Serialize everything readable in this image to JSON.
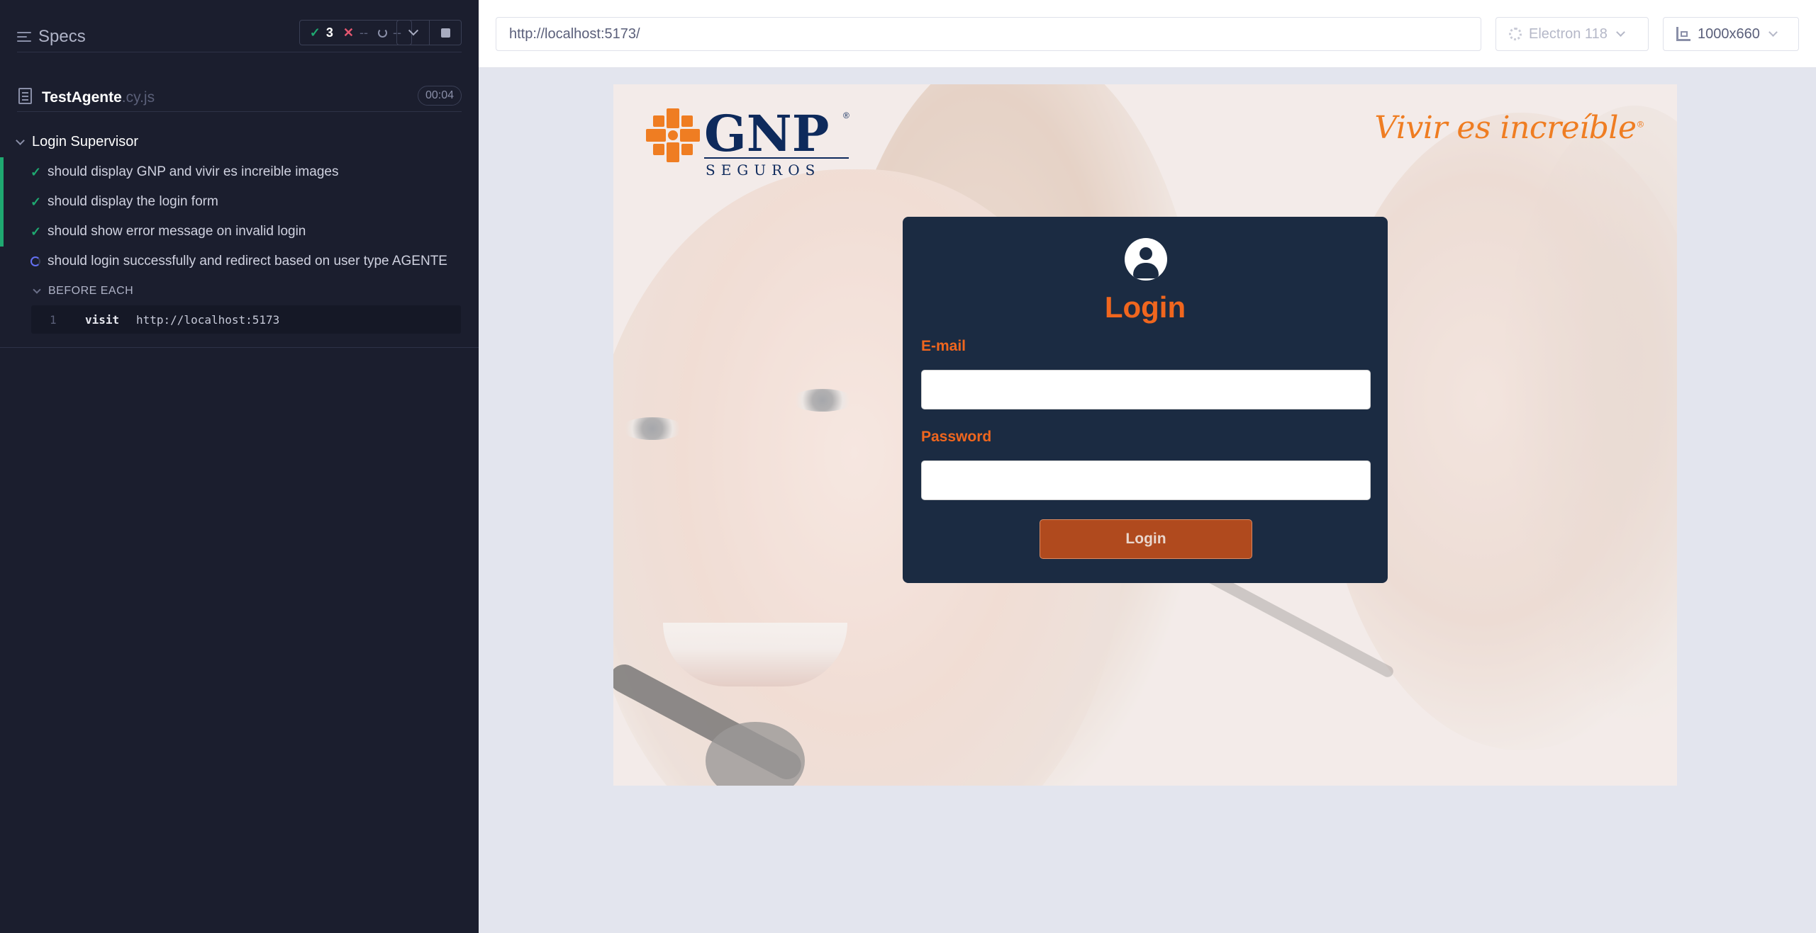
{
  "reporter": {
    "specs_label": "Specs",
    "stats": {
      "passed": "3",
      "failed": "--",
      "pending": "--"
    },
    "spec": {
      "name": "TestAgente",
      "ext": ".cy.js",
      "duration": "00:04"
    },
    "suite": {
      "title": "Login Supervisor",
      "tests": [
        {
          "label": "should display GNP and vivir es increible images",
          "state": "passed"
        },
        {
          "label": "should display the login form",
          "state": "passed"
        },
        {
          "label": "should show error message on invalid login",
          "state": "passed"
        },
        {
          "label": "should login successfully and redirect based on user type AGENTE",
          "state": "running"
        }
      ],
      "hook": "BEFORE EACH",
      "command": {
        "number": "1",
        "name": "visit",
        "message": "http://localhost:5173"
      }
    }
  },
  "topbar": {
    "url": "http://localhost:5173/",
    "browser": "Electron 118",
    "viewport": "1000x660"
  },
  "app": {
    "logo_text": "GNP",
    "logo_subtext": "SEGUROS",
    "slogan": "Vivir es increíble",
    "login_title": "Login",
    "email_label": "E-mail",
    "email_value": "",
    "password_label": "Password",
    "password_value": "",
    "login_button": "Login"
  },
  "colors": {
    "accent_orange": "#f0661e",
    "card_navy": "#1b2b42",
    "pass_green": "#1fa971",
    "reporter_bg": "#1b1e2e"
  }
}
